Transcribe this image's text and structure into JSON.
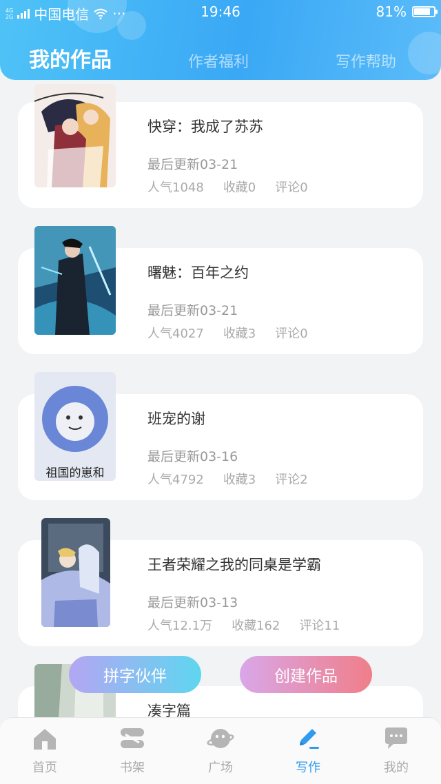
{
  "status_bar": {
    "net_top": "4G",
    "net_bottom": "2G",
    "carrier": "中国电信",
    "more": "···",
    "time": "19:46",
    "battery": "81%"
  },
  "header": {
    "tabs": [
      {
        "label": "我的作品",
        "active": true
      },
      {
        "label": "作者福利",
        "active": false
      },
      {
        "label": "写作帮助",
        "active": false
      }
    ]
  },
  "works": [
    {
      "title": "快穿：我成了苏苏",
      "updated": "最后更新03-21",
      "popularity": "人气1048",
      "favorites": "收藏0",
      "comments": "评论0"
    },
    {
      "title": "曙魅：百年之约",
      "updated": "最后更新03-21",
      "popularity": "人气4027",
      "favorites": "收藏3",
      "comments": "评论0"
    },
    {
      "title": "班宠的谢",
      "updated": "最后更新03-16",
      "popularity": "人气4792",
      "favorites": "收藏3",
      "comments": "评论2",
      "cover_text": "祖国的崽和"
    },
    {
      "title": "王者荣耀之我的同桌是学霸",
      "updated": "最后更新03-13",
      "popularity": "人气12.1万",
      "favorites": "收藏162",
      "comments": "评论11"
    },
    {
      "title": "凑字篇"
    }
  ],
  "actions": {
    "partner": "拼字伙伴",
    "create": "创建作品"
  },
  "bottom_nav": [
    {
      "label": "首页",
      "icon": "home-icon",
      "active": false
    },
    {
      "label": "书架",
      "icon": "bookshelf-icon",
      "active": false
    },
    {
      "label": "广场",
      "icon": "planet-icon",
      "active": false
    },
    {
      "label": "写作",
      "icon": "pen-icon",
      "active": true
    },
    {
      "label": "我的",
      "icon": "chat-icon",
      "active": false
    }
  ],
  "colors": {
    "accent": "#2f9cf0",
    "header_start": "#4fc3f7",
    "header_end": "#3aa8f5",
    "inactive": "#aaaaaa"
  }
}
